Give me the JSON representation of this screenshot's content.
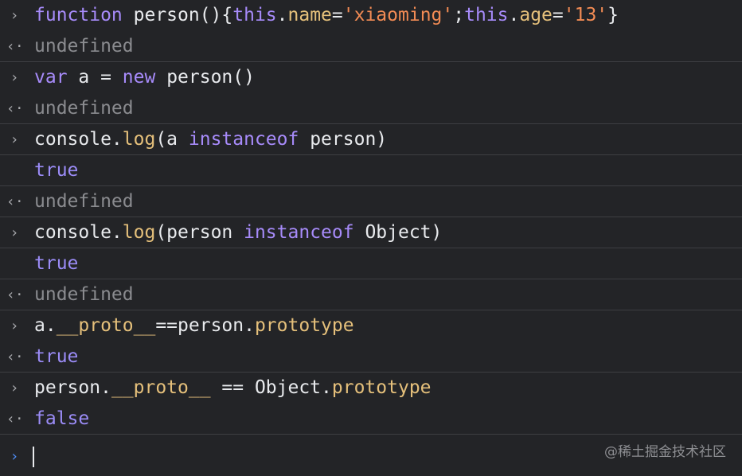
{
  "colors": {
    "background": "#232427",
    "keyword": "#a78bfa",
    "property": "#e5c07b",
    "string": "#f28b54",
    "undefined": "#8a8b8f",
    "prompt_active": "#4f8ef7"
  },
  "icons": {
    "input_marker": "chevron-right-icon",
    "output_marker": "return-arrow-icon"
  },
  "markers": {
    "input": "›",
    "output": "‹·"
  },
  "lines": [
    {
      "kind": "input",
      "tokens": [
        {
          "t": "function",
          "c": "kw"
        },
        {
          "t": " person(){",
          "c": "plain"
        },
        {
          "t": "this",
          "c": "kw"
        },
        {
          "t": ".",
          "c": "plain"
        },
        {
          "t": "name",
          "c": "prop"
        },
        {
          "t": "=",
          "c": "plain"
        },
        {
          "t": "'xiaoming'",
          "c": "str"
        },
        {
          "t": ";",
          "c": "plain"
        },
        {
          "t": "this",
          "c": "kw"
        },
        {
          "t": ".",
          "c": "plain"
        },
        {
          "t": "age",
          "c": "prop"
        },
        {
          "t": "=",
          "c": "plain"
        },
        {
          "t": "'13'",
          "c": "str"
        },
        {
          "t": "}",
          "c": "plain"
        }
      ]
    },
    {
      "kind": "output",
      "sep": true,
      "tokens": [
        {
          "t": "undefined",
          "c": "undef"
        }
      ]
    },
    {
      "kind": "input",
      "tokens": [
        {
          "t": "var",
          "c": "kw"
        },
        {
          "t": " a = ",
          "c": "plain"
        },
        {
          "t": "new",
          "c": "kw"
        },
        {
          "t": " person()",
          "c": "plain"
        }
      ]
    },
    {
      "kind": "output",
      "sep": true,
      "tokens": [
        {
          "t": "undefined",
          "c": "undef"
        }
      ]
    },
    {
      "kind": "input",
      "sep": true,
      "tokens": [
        {
          "t": "console.",
          "c": "plain"
        },
        {
          "t": "log",
          "c": "prop"
        },
        {
          "t": "(a ",
          "c": "plain"
        },
        {
          "t": "instanceof",
          "c": "kw"
        },
        {
          "t": " person)",
          "c": "plain"
        }
      ]
    },
    {
      "kind": "log",
      "sep": true,
      "tokens": [
        {
          "t": "true",
          "c": "bool"
        }
      ]
    },
    {
      "kind": "output",
      "sep": true,
      "tokens": [
        {
          "t": "undefined",
          "c": "undef"
        }
      ]
    },
    {
      "kind": "input",
      "sep": true,
      "tokens": [
        {
          "t": "console.",
          "c": "plain"
        },
        {
          "t": "log",
          "c": "prop"
        },
        {
          "t": "(person ",
          "c": "plain"
        },
        {
          "t": "instanceof",
          "c": "kw"
        },
        {
          "t": " Object)",
          "c": "plain"
        }
      ]
    },
    {
      "kind": "log",
      "sep": true,
      "tokens": [
        {
          "t": "true",
          "c": "bool"
        }
      ]
    },
    {
      "kind": "output",
      "sep": true,
      "tokens": [
        {
          "t": "undefined",
          "c": "undef"
        }
      ]
    },
    {
      "kind": "input",
      "tokens": [
        {
          "t": "a.",
          "c": "plain"
        },
        {
          "t": "__proto__",
          "c": "prop"
        },
        {
          "t": "==person.",
          "c": "plain"
        },
        {
          "t": "prototype",
          "c": "prop"
        }
      ]
    },
    {
      "kind": "output",
      "sep": true,
      "tokens": [
        {
          "t": "true",
          "c": "bool"
        }
      ]
    },
    {
      "kind": "input",
      "tokens": [
        {
          "t": "person.",
          "c": "plain"
        },
        {
          "t": "__proto__",
          "c": "prop"
        },
        {
          "t": " == Object.",
          "c": "plain"
        },
        {
          "t": "prototype",
          "c": "prop"
        }
      ]
    },
    {
      "kind": "output",
      "sep": true,
      "tokens": [
        {
          "t": "false",
          "c": "bool"
        }
      ]
    }
  ],
  "prompt": {
    "marker": "›",
    "value": ""
  },
  "watermark": "@稀土掘金技术社区"
}
